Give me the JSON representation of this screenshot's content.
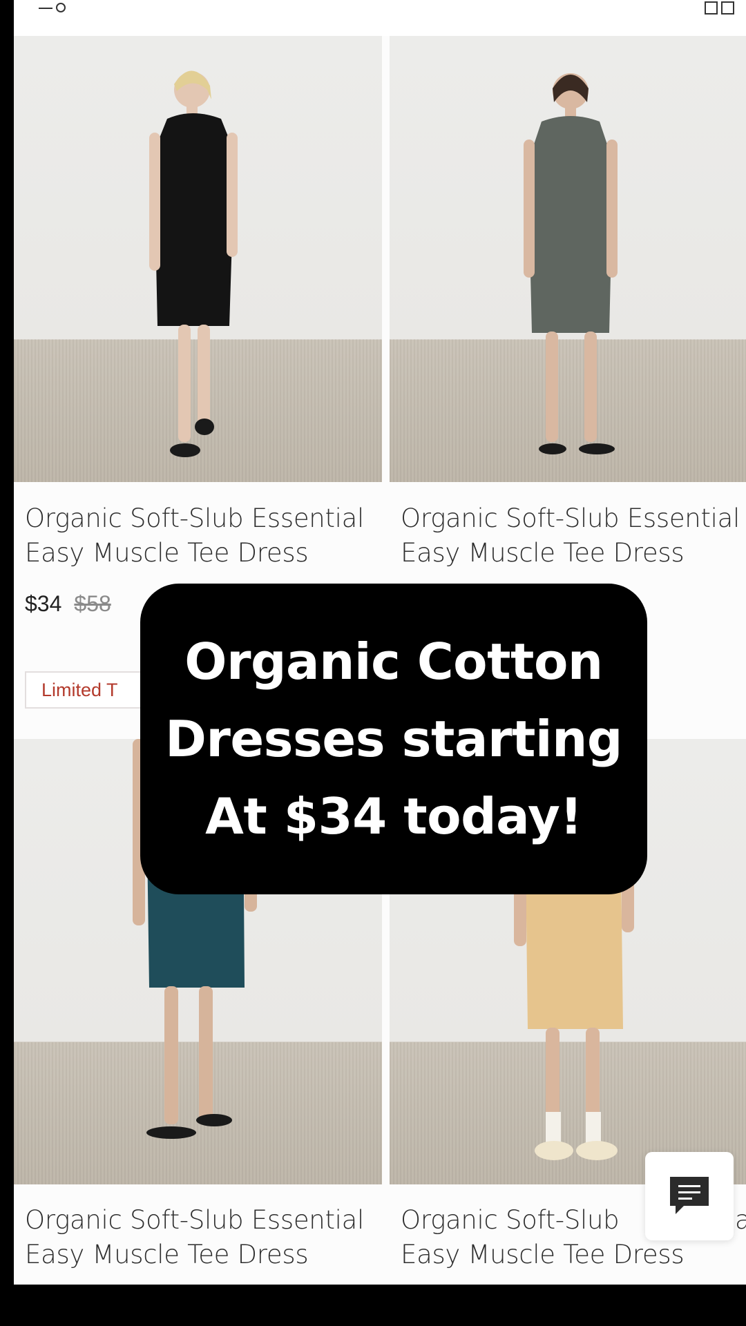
{
  "header": {
    "filter_icon": "filter-icon",
    "grid_icon": "two-column-grid-icon"
  },
  "products": [
    {
      "title_line1": "Organic Soft-Slub Essential",
      "title_line2": "Easy Muscle Tee Dress",
      "price": "$34",
      "original_price": "$58",
      "badge": "Limited T",
      "dress_color": "#141414"
    },
    {
      "title_line1": "Organic Soft-Slub Essential",
      "title_line2": "Easy Muscle Tee Dress",
      "dress_color": "#5f6660"
    },
    {
      "title_line1": "Organic Soft-Slub Essential",
      "title_line2": "Easy Muscle Tee Dress",
      "dress_color": "#1f4d5a"
    },
    {
      "title_line1": "Organic Soft-Slub",
      "title_line1_end": "al",
      "title_line2": "Easy Muscle Tee Dress",
      "dress_color": "#e6c48d"
    }
  ],
  "promo": {
    "line1": "Organic Cotton",
    "line2": "Dresses starting",
    "line3": "At $34 today!"
  },
  "chat": {
    "icon": "chat-icon"
  }
}
